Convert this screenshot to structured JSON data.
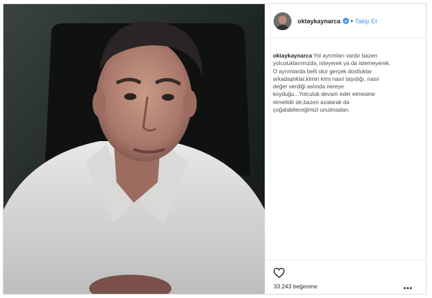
{
  "post": {
    "username": "oktaykaynarca",
    "dot_separator": "•",
    "follow_label": "Takip Et",
    "caption_username": "oktaykaynarca",
    "caption_lines": [
      "Yol ayrımları vardır bazen",
      "yolculuklarımızda, isteyerek ya da istemeyerek.",
      "O ayrımlarda belli olur gerçek dostluklar",
      "arkadaşlıklar,kimin kimi nasıl taşıdığı, nasıl",
      "değer verdiği aslında nereye",
      "koyduğu...Yolculuk devam eder etmesine",
      "etmelidir de,bazen azalarak da",
      "çoğalabileceğimizi unutmadan."
    ],
    "likes_text": "33.243 beğenme",
    "more_label": "•••"
  },
  "colors": {
    "link_blue": "#3897f0",
    "verified_blue": "#3897f0",
    "border": "#dbdbdb"
  },
  "icons": {
    "verified": "verified-badge-icon",
    "heart": "heart-outline-icon",
    "more": "more-options-icon"
  }
}
